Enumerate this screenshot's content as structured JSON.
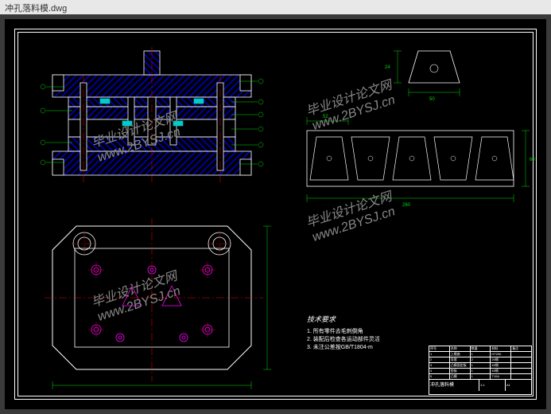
{
  "window": {
    "title": "冲孔落料模.dwg"
  },
  "watermark": {
    "line1": "毕业设计论文网",
    "line2": "www.2BYSJ.cn"
  },
  "notes": {
    "title": "技术要求",
    "lines": [
      "1. 所有零件去毛刺倒角",
      "2. 装配后检查各运动部件灵活",
      "3. 未注公差按GB/T1804-m"
    ]
  },
  "dimensions": {
    "part_width": "50",
    "part_height": "24",
    "strip_length": "260",
    "strip_width": "60",
    "pitch": "52"
  },
  "titleblock": {
    "rows": [
      [
        "序号",
        "名称",
        "数量",
        "材料",
        "备注"
      ],
      [
        "1",
        "上模座",
        "1",
        "HT200",
        ""
      ],
      [
        "2",
        "导套",
        "2",
        "20钢",
        ""
      ],
      [
        "3",
        "凸模固定板",
        "1",
        "45钢",
        ""
      ],
      [
        "4",
        "垫板",
        "1",
        "45钢",
        ""
      ],
      [
        "5",
        "凸模",
        "1",
        "T10A",
        ""
      ],
      [
        "6",
        "卸料板",
        "1",
        "45钢",
        ""
      ],
      [
        "7",
        "凹模",
        "1",
        "Cr12",
        ""
      ],
      [
        "8",
        "下模座",
        "1",
        "HT200",
        ""
      ]
    ],
    "project": "冲孔落料模",
    "scale": "1:1",
    "sheet": "A1"
  },
  "colors": {
    "hatch": "#0000cc",
    "outline": "#ffffff",
    "centerline": "#ff0000",
    "hidden": "#ff00ff",
    "dim": "#00dd00",
    "accent": "#00cccc"
  }
}
